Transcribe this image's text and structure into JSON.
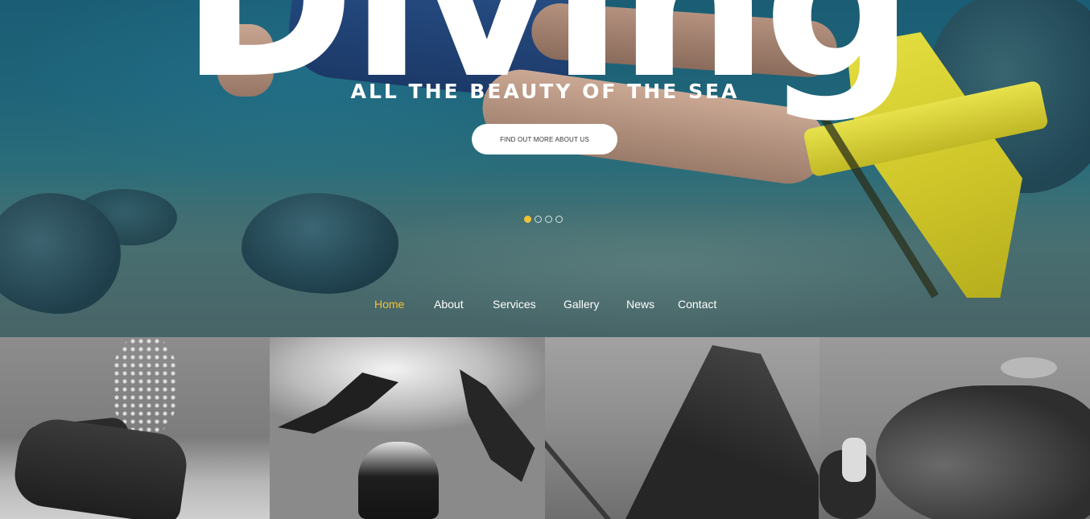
{
  "hero": {
    "title": "Diving",
    "subtitle": "ALL THE BEAUTY OF THE SEA",
    "cta_label": "FIND OUT MORE ABOUT US",
    "slides": {
      "count": 4,
      "active_index": 0
    }
  },
  "nav": {
    "items": [
      {
        "label": "Home",
        "active": true
      },
      {
        "label": "About",
        "active": false
      },
      {
        "label": "Services",
        "active": false
      },
      {
        "label": "Gallery",
        "active": false
      },
      {
        "label": "News",
        "active": false
      },
      {
        "label": "Contact",
        "active": false
      }
    ]
  },
  "gallery": {
    "tiles": [
      {
        "subject": "scuba-diver-with-bubbles"
      },
      {
        "subject": "manta-rays-and-diver"
      },
      {
        "subject": "shipwreck"
      },
      {
        "subject": "grouper-fish-and-diver"
      }
    ]
  },
  "colors": {
    "accent": "#f2c232",
    "nav_text": "#ffffff",
    "cta_bg": "#ffffff",
    "cta_text": "#333333"
  }
}
